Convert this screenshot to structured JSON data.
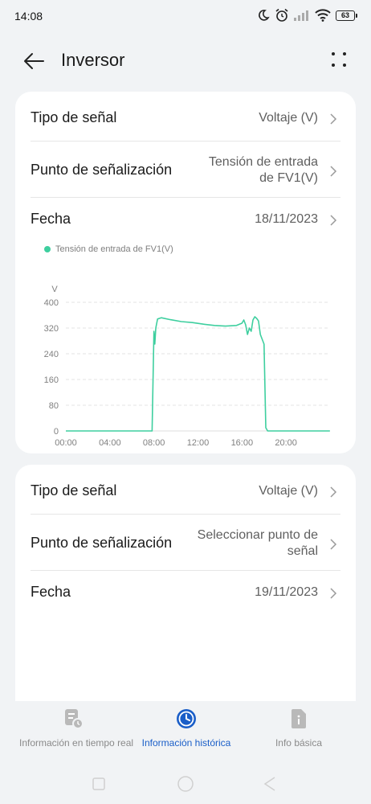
{
  "status_bar": {
    "time": "14:08",
    "battery": "63"
  },
  "app_bar": {
    "title": "Inversor"
  },
  "card1": {
    "signal_type_label": "Tipo de señal",
    "signal_type_value": "Voltaje (V)",
    "signal_point_label": "Punto de señalización",
    "signal_point_value_line1": "Tensión de entrada",
    "signal_point_value_line2": "de FV1(V)",
    "date_label": "Fecha",
    "date_value": "18/11/2023"
  },
  "chart_data": {
    "type": "line",
    "series": [
      {
        "name": "Tensión de entrada de FV1(V)",
        "color": "#3ecf9f",
        "x": [
          "00:00",
          "04:00",
          "07:50",
          "08:00",
          "08:05",
          "08:10",
          "08:20",
          "08:40",
          "09:30",
          "10:30",
          "11:30",
          "12:30",
          "13:30",
          "14:30",
          "15:30",
          "16:00",
          "16:10",
          "16:20",
          "16:30",
          "16:40",
          "16:50",
          "17:00",
          "17:10",
          "17:20",
          "17:30",
          "17:40",
          "17:50",
          "18:00",
          "18:10",
          "18:20",
          "18:30",
          "19:00",
          "20:00",
          "23:59"
        ],
        "values": [
          0,
          0,
          0,
          310,
          270,
          320,
          348,
          352,
          346,
          340,
          337,
          332,
          328,
          326,
          328,
          335,
          345,
          330,
          300,
          320,
          310,
          345,
          355,
          350,
          342,
          300,
          285,
          270,
          10,
          0,
          0,
          0,
          0,
          0
        ]
      }
    ],
    "ylabel": "V",
    "yticks": [
      0,
      80,
      160,
      240,
      320,
      400
    ],
    "xticks": [
      "00:00",
      "04:00",
      "08:00",
      "12:00",
      "16:00",
      "20:00"
    ],
    "ylim": [
      0,
      400
    ],
    "grid": true,
    "legend": "top-left"
  },
  "card2": {
    "signal_type_label": "Tipo de señal",
    "signal_type_value": "Voltaje (V)",
    "signal_point_label": "Punto de señalización",
    "signal_point_value_line1": "Seleccionar punto de",
    "signal_point_value_line2": "señal",
    "date_label": "Fecha",
    "date_value": "19/11/2023"
  },
  "bottom_nav": {
    "items": [
      {
        "label": "Información en tiempo real",
        "icon": "realtime-doc-icon",
        "active": false
      },
      {
        "label": "Información histórica",
        "icon": "clock-icon",
        "active": true
      },
      {
        "label": "Info básica",
        "icon": "info-doc-icon",
        "active": false
      }
    ],
    "active_color": "#1a5ec8",
    "inactive_color": "#8a8a8a"
  },
  "colors": {
    "background": "#f1f3f5",
    "card": "#ffffff",
    "series": "#3ecf9f",
    "accent": "#1a5ec8"
  }
}
